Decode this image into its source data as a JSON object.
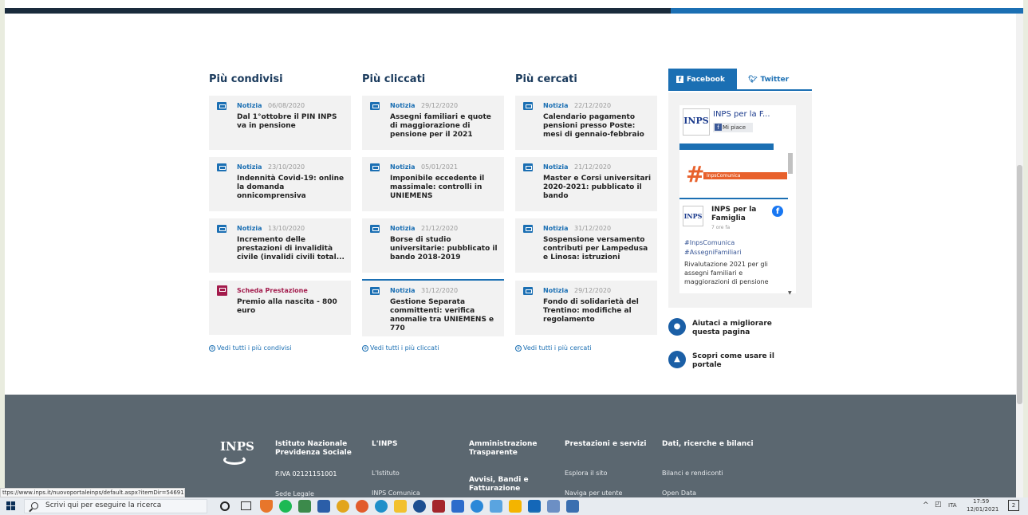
{
  "columns": [
    {
      "title": "Più condivisi",
      "see_all": "Vedi tutti i più condivisi",
      "cards": [
        {
          "category": "Notizia",
          "date": "06/08/2020",
          "title": "Dal 1°ottobre il PIN INPS va in pensione"
        },
        {
          "category": "Notizia",
          "date": "23/10/2020",
          "title": "Indennità Covid-19: online la domanda onnicomprensiva"
        },
        {
          "category": "Notizia",
          "date": "13/10/2020",
          "title": "Incremento delle prestazioni di invalidità civile (invalidi civili total..."
        },
        {
          "category": "Scheda Prestazione",
          "date": "",
          "title": "Premio alla nascita - 800 euro"
        }
      ]
    },
    {
      "title": "Più cliccati",
      "see_all": "Vedi tutti i più cliccati",
      "cards": [
        {
          "category": "Notizia",
          "date": "29/12/2020",
          "title": "Assegni familiari e quote di maggiorazione di pensione per il 2021"
        },
        {
          "category": "Notizia",
          "date": "05/01/2021",
          "title": "Imponibile eccedente il massimale: controlli in UNIEMENS"
        },
        {
          "category": "Notizia",
          "date": "21/12/2020",
          "title": "Borse di studio universitarie: pubblicato il bando 2018-2019"
        },
        {
          "category": "Notizia",
          "date": "31/12/2020",
          "title": "Gestione Separata committenti: verifica anomalie tra UNIEMENS e 770"
        }
      ]
    },
    {
      "title": "Più cercati",
      "see_all": "Vedi tutti i più cercati",
      "cards": [
        {
          "category": "Notizia",
          "date": "22/12/2020",
          "title": "Calendario pagamento pensioni presso Poste: mesi di gennaio-febbraio"
        },
        {
          "category": "Notizia",
          "date": "21/12/2020",
          "title": "Master e Corsi universitari 2020-2021: pubblicato il bando"
        },
        {
          "category": "Notizia",
          "date": "31/12/2020",
          "title": "Sospensione versamento contributi per Lampedusa e Linosa: istruzioni"
        },
        {
          "category": "Notizia",
          "date": "29/12/2020",
          "title": "Fondo di solidarietà del Trentino: modifiche al regolamento"
        }
      ]
    }
  ],
  "social": {
    "tab_facebook": "Facebook",
    "tab_twitter": "Twitter",
    "fb_page_name": "INPS per la F...",
    "fb_like": "Mi piace",
    "fb_cover_label": "InpsComunica",
    "post_name": "INPS per la Famiglia",
    "post_time": "7 ore fa",
    "post_tag1": "#InpsComunica",
    "post_tag2": "#AssegniFamiliari",
    "post_body": "Rivalutazione 2021 per gli assegni familiari e maggiorazioni di pensione"
  },
  "aside": {
    "help_label": "Aiutaci a migliorare questa pagina",
    "discover_label": "Scopri come usare il portale"
  },
  "footer": {
    "logo_text": "INPS",
    "institute": "Istituto Nazionale Previdenza Sociale",
    "piva": "P.IVA 02121151001",
    "legal": "Sede Legale",
    "col_inps": "L'INPS",
    "link_istituto": "L'Istituto",
    "link_comunica": "INPS Comunica",
    "col_amm": "Amministrazione Trasparente",
    "col_avvisi": "Avvisi, Bandi e Fatturazione",
    "col_prest": "Prestazioni e servizi",
    "link_esplora": "Esplora il sito",
    "link_naviga": "Naviga per utente",
    "col_dati": "Dati, ricerche e bilanci",
    "link_bilanci": "Bilanci e rendiconti",
    "link_open": "Open Data"
  },
  "status_url": "ttps://www.inps.it/nuovoportaleinps/default.aspx?itemDir=54691",
  "taskbar": {
    "search_placeholder": "Scrivi qui per eseguire la ricerca",
    "lang": "ITA",
    "time": "17:59",
    "date": "12/01/2021",
    "notif_count": "2"
  },
  "colors": {
    "accent": "#1b6fb3",
    "scheda": "#a31b4c",
    "footer_bg": "#5b6770"
  }
}
